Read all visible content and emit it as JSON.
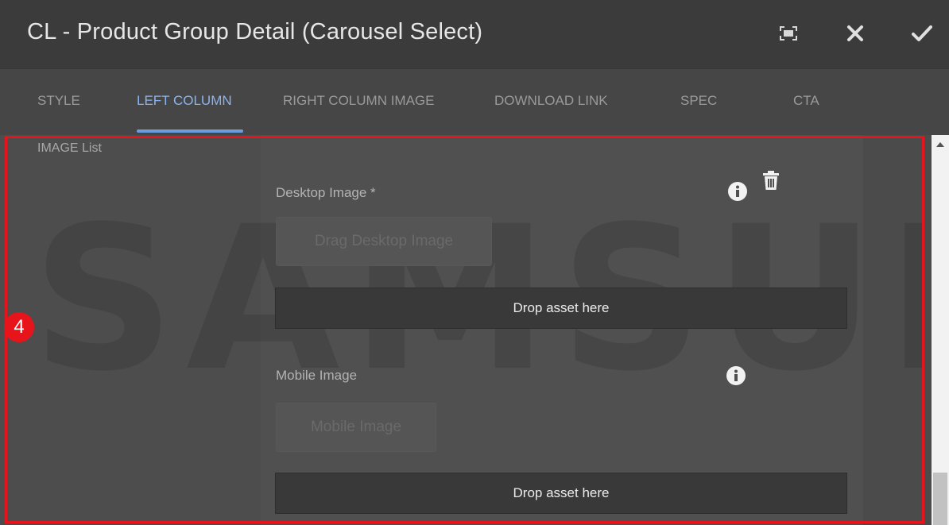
{
  "dialog": {
    "title": "CL - Product Group Detail (Carousel Select)",
    "fullscreen_icon": "fullscreen-icon",
    "close_icon": "close-icon",
    "confirm_icon": "check-icon"
  },
  "tabs": [
    {
      "label": "STYLE",
      "active": false
    },
    {
      "label": "LEFT COLUMN",
      "active": true
    },
    {
      "label": "RIGHT COLUMN IMAGE",
      "active": false
    },
    {
      "label": "DOWNLOAD LINK",
      "active": false
    },
    {
      "label": "SPEC",
      "active": false
    },
    {
      "label": "CTA",
      "active": false
    }
  ],
  "section": {
    "label": "IMAGE List"
  },
  "desktop_image": {
    "label": "Desktop Image *",
    "drag_placeholder": "Drag Desktop Image",
    "drop_label": "Drop asset here",
    "info_icon": "info-icon",
    "delete_icon": "trash-icon"
  },
  "mobile_image": {
    "label": "Mobile Image",
    "drag_placeholder": "Mobile Image",
    "drop_label": "Drop asset here",
    "info_icon": "info-icon"
  },
  "watermark": "SAMSUNG",
  "annotation": {
    "step": "4",
    "color": "#e8141b"
  },
  "colors": {
    "accent": "#6d9ce0",
    "active_tab": "#8ab4ef"
  }
}
